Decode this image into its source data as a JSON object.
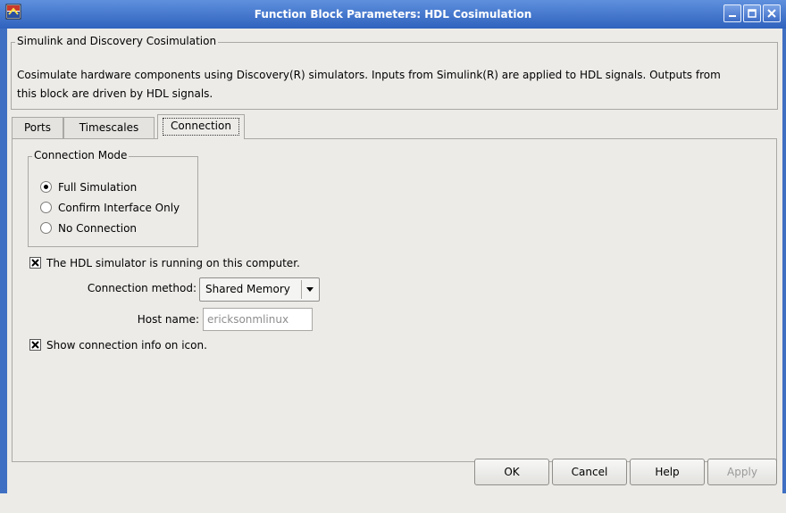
{
  "window": {
    "title": "Function Block Parameters: HDL Cosimulation"
  },
  "description": {
    "group_title": "Simulink and Discovery Cosimulation",
    "line1": "Cosimulate hardware components using Discovery(R) simulators.  Inputs from Simulink(R) are applied to HDL signals.  Outputs from",
    "line2": "this block are driven by HDL signals."
  },
  "tabs": [
    {
      "label": "Ports"
    },
    {
      "label": "Timescales"
    },
    {
      "label": "Connection",
      "selected": true
    }
  ],
  "connection_mode": {
    "group_title": "Connection Mode",
    "options": [
      {
        "label": "Full Simulation",
        "selected": true
      },
      {
        "label": "Confirm Interface Only",
        "selected": false
      },
      {
        "label": "No Connection",
        "selected": false
      }
    ]
  },
  "hdl_running_local": {
    "label": "The HDL simulator is running on this computer.",
    "checked": true
  },
  "connection_method": {
    "label": "Connection method:",
    "value": "Shared Memory"
  },
  "host_name": {
    "label": "Host name:",
    "value": "ericksonmlinux"
  },
  "show_info": {
    "label": "Show connection info on icon.",
    "checked": true
  },
  "buttons": {
    "ok": "OK",
    "cancel": "Cancel",
    "help": "Help",
    "apply": "Apply"
  },
  "colors": {
    "titlebar": "#2f62be",
    "background": "#ecebe8"
  }
}
